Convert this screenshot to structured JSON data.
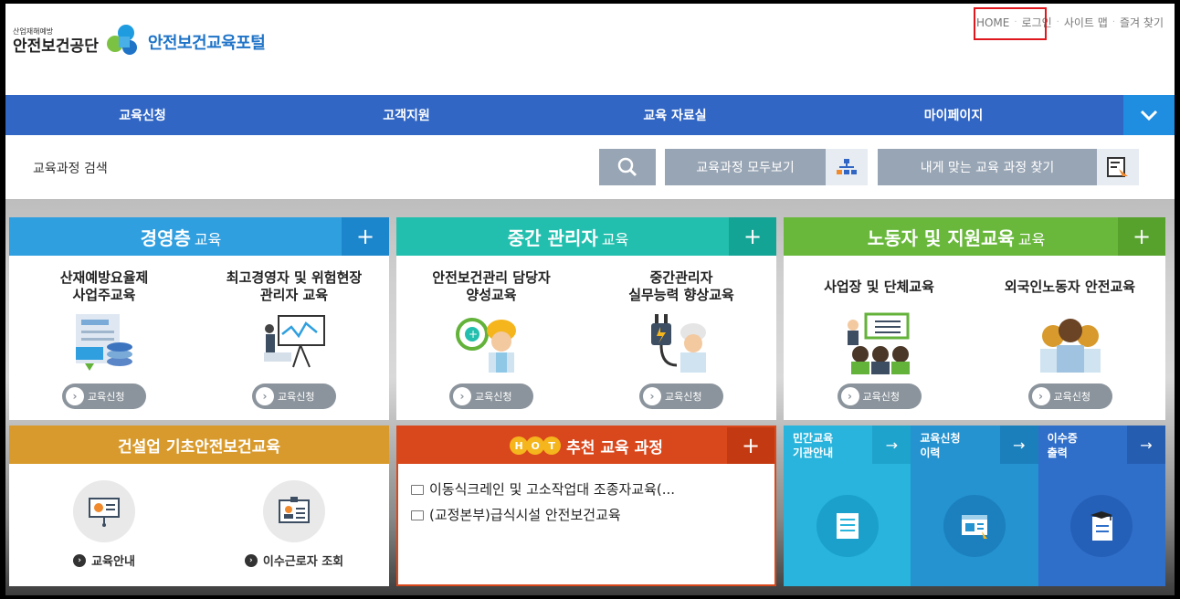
{
  "header": {
    "org_small": "산업재해예방",
    "org_name": "안전보건공단",
    "portal_name": "안전보건교육포털",
    "util": [
      "HOME",
      "로그인",
      "사이트 맵",
      "즐겨 찾기"
    ]
  },
  "gnb": {
    "items": [
      "교육신청",
      "고객지원",
      "교육 자료실",
      "마이페이지"
    ]
  },
  "search": {
    "label": "교육과정 검색",
    "placeholder": "",
    "all_courses": "교육과정 모두보기",
    "my_course": "내게 맞는 교육 과정 찾기"
  },
  "cards": {
    "exec": {
      "title": "경영층",
      "sub": "교육",
      "courses": [
        {
          "name": "산재예방요율제\n사업주교육",
          "btn": "교육신청"
        },
        {
          "name": "최고경영자 및 위험현장\n관리자 교육",
          "btn": "교육신청"
        }
      ]
    },
    "mid": {
      "title": "중간 관리자",
      "sub": "교육",
      "courses": [
        {
          "name": "안전보건관리 담당자\n양성교육",
          "btn": "교육신청"
        },
        {
          "name": "중간관리자\n실무능력 향상교육",
          "btn": "교육신청"
        }
      ]
    },
    "labor": {
      "title": "노동자 및 지원교육",
      "sub": "교육",
      "courses": [
        {
          "name": "사업장 및 단체교육",
          "btn": "교육신청"
        },
        {
          "name": "외국인노동자 안전교육",
          "btn": "교육신청"
        }
      ]
    },
    "construct": {
      "title": "건설업 기초안전보건교육",
      "items": [
        "교육안내",
        "이수근로자 조회"
      ]
    },
    "hot": {
      "badge": [
        "H",
        "O",
        "T"
      ],
      "title": "추천 교육 과정",
      "items": [
        "이동식크레인 및 고소작업대 조종자교육(...",
        "(교정본부)급식시설 안전보건교육"
      ]
    },
    "side": [
      {
        "label": "민간교육\n기관안내",
        "color": "#28b4dc"
      },
      {
        "label": "교육신청\n이력",
        "color": "#2493d0"
      },
      {
        "label": "이수증\n출력",
        "color": "#2f6fca"
      }
    ]
  },
  "colors": {
    "gnb": "#3166c4",
    "login_highlight": "#e0171d"
  }
}
